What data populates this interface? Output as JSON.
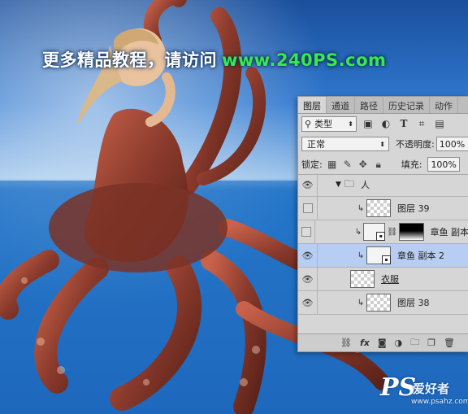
{
  "banner": {
    "cn": "更多精品教程，请访问",
    "url": "www.240PS.com"
  },
  "logo": {
    "mark": "PS",
    "cn": "爱好者",
    "site": "www.psahz.com"
  },
  "panel": {
    "tabs": [
      "图层",
      "通道",
      "路径",
      "历史记录",
      "动作"
    ],
    "active_tab": "图层",
    "filter": {
      "kind_label": "类型",
      "icons": [
        "image-filter-icon",
        "adjustment-filter-icon",
        "type-filter-icon",
        "shape-filter-icon",
        "smart-object-filter-icon"
      ]
    },
    "blend_mode": "正常",
    "opacity_label": "不透明度:",
    "opacity_value": "100%",
    "lock_label": "锁定:",
    "fill_label": "填充:",
    "fill_value": "100%",
    "layers": [
      {
        "name": "人",
        "type": "group",
        "visible": true
      },
      {
        "name": "图层 39",
        "type": "layer",
        "visible": false,
        "clipped": true
      },
      {
        "name": "章鱼 副本",
        "type": "smart-with-mask",
        "visible": false,
        "clipped": true
      },
      {
        "name": "章鱼 副本 2",
        "type": "smart",
        "visible": true,
        "clipped": true,
        "selected": true
      },
      {
        "name": "衣服",
        "type": "layer",
        "visible": true,
        "clipped": false
      },
      {
        "name": "图层 38",
        "type": "layer",
        "visible": true,
        "clipped": true
      }
    ],
    "footer_icons": [
      "link-icon",
      "fx-icon",
      "mask-icon",
      "adjustment-icon",
      "group-icon",
      "new-layer-icon",
      "trash-icon"
    ]
  },
  "colors": {
    "banner_url": "#39e84f",
    "selected_layer": "#b7cdf2"
  }
}
